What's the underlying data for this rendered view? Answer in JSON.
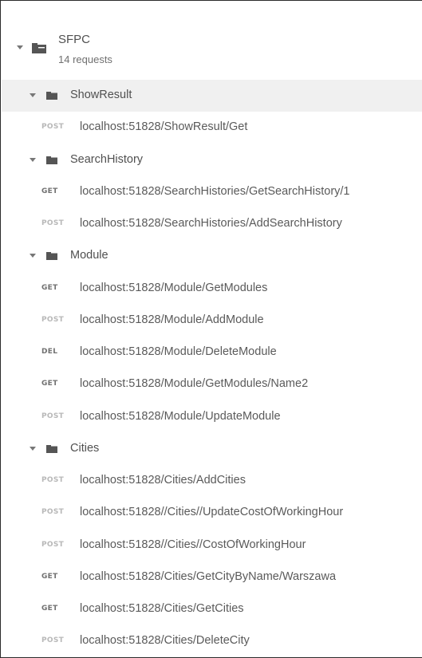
{
  "collection": {
    "name": "SFPC",
    "request_count": "14 requests",
    "expanded": true
  },
  "tree": [
    {
      "kind": "folder",
      "label": "ShowResult",
      "active": true
    },
    {
      "kind": "request",
      "method": "POST",
      "url": "localhost:51828/ShowResult/Get"
    },
    {
      "kind": "folder",
      "label": "SearchHistory",
      "active": false
    },
    {
      "kind": "request",
      "method": "GET",
      "url": "localhost:51828/SearchHistories/GetSearchHistory/1"
    },
    {
      "kind": "request",
      "method": "POST",
      "url": "localhost:51828/SearchHistories/AddSearchHistory"
    },
    {
      "kind": "folder",
      "label": "Module",
      "active": false
    },
    {
      "kind": "request",
      "method": "GET",
      "url": "localhost:51828/Module/GetModules"
    },
    {
      "kind": "request",
      "method": "POST",
      "url": "localhost:51828/Module/AddModule"
    },
    {
      "kind": "request",
      "method": "DEL",
      "url": "localhost:51828/Module/DeleteModule"
    },
    {
      "kind": "request",
      "method": "GET",
      "url": "localhost:51828/Module/GetModules/Name2"
    },
    {
      "kind": "request",
      "method": "POST",
      "url": "localhost:51828/Module/UpdateModule"
    },
    {
      "kind": "folder",
      "label": "Cities",
      "active": false
    },
    {
      "kind": "request",
      "method": "POST",
      "url": "localhost:51828/Cities/AddCities"
    },
    {
      "kind": "request",
      "method": "POST",
      "url": "localhost:51828//Cities//UpdateCostOfWorkingHour"
    },
    {
      "kind": "request",
      "method": "POST",
      "url": "localhost:51828//Cities//CostOfWorkingHour"
    },
    {
      "kind": "request",
      "method": "GET",
      "url": "localhost:51828/Cities/GetCityByName/Warszawa"
    },
    {
      "kind": "request",
      "method": "GET",
      "url": "localhost:51828/Cities/GetCities"
    },
    {
      "kind": "request",
      "method": "POST",
      "url": "localhost:51828/Cities/DeleteCity"
    }
  ],
  "icons": {
    "collection": "collection-folder-icon",
    "folder": "folder-icon",
    "caret": "caret-down-icon"
  },
  "colors": {
    "active_row": "#f0f0f0",
    "text": "#505050",
    "method_post": "#b8b8b8",
    "method_get": "#707070",
    "method_del": "#707070",
    "icon": "#555555"
  }
}
